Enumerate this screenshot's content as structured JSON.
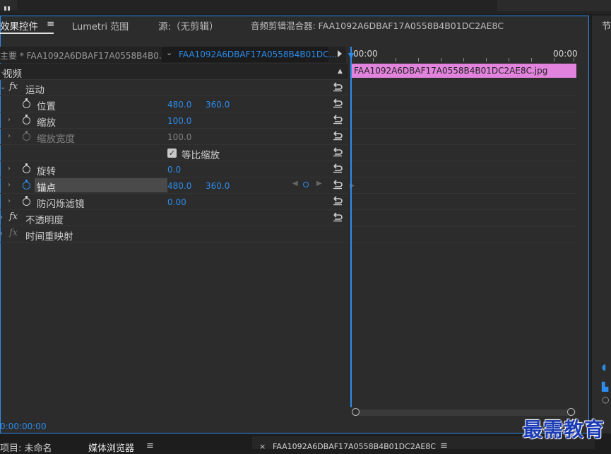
{
  "tabs": {
    "effect_controls": "效果控件",
    "menu": "≡",
    "lumetri": "Lumetri 范围",
    "source": "源:（无剪辑）",
    "audio_mixer": "音频剪辑混合器: FAA1092A6DBAF17A0558B4B01DC2AE8C"
  },
  "right_panel": {
    "label": "节"
  },
  "header": {
    "master": "主要 * FAA1092A6DBAF17A0558B4B0...",
    "clip_select": "FAA1092A6DBAF17A0558B4B01DC...",
    "chevron": "⌄"
  },
  "rows": {
    "video": {
      "label": "视频"
    },
    "motion": {
      "label": "运动"
    },
    "position": {
      "label": "位置",
      "x": "480.0",
      "y": "360.0"
    },
    "scale": {
      "label": "缩放",
      "value": "100.0"
    },
    "scale_width": {
      "label": "缩放宽度",
      "value": "100.0"
    },
    "uniform_scale": {
      "label": "等比缩放",
      "checked": true
    },
    "rotation": {
      "label": "旋转",
      "value": "0.0"
    },
    "anchor": {
      "label": "锚点",
      "x": "480.0",
      "y": "360.0"
    },
    "antiflicker": {
      "label": "防闪烁滤镜",
      "value": "0.00"
    },
    "opacity": {
      "label": "不透明度"
    },
    "time_remap": {
      "label": "时间重映射"
    }
  },
  "fx": "fx",
  "timeline": {
    "time_start": "00:00",
    "time_end": "00:00",
    "clip_name": "FAA1092A6DBAF17A0558B4B01DC2AE8C.jpg",
    "clip_color": "#e283dd"
  },
  "timecode": "0:00:00:00",
  "bottom_tabs": {
    "project": "项目: 未命名",
    "media_browser": "媒体浏览器",
    "menu": "≡",
    "close": "×",
    "sequence": "FAA1092A6DBAF17A0558B4B01DC2AE8C"
  },
  "watermark": "最需教育",
  "colors": {
    "accent": "#2d8ceb",
    "panel": "#2c2c2c",
    "clip": "#e283dd"
  }
}
